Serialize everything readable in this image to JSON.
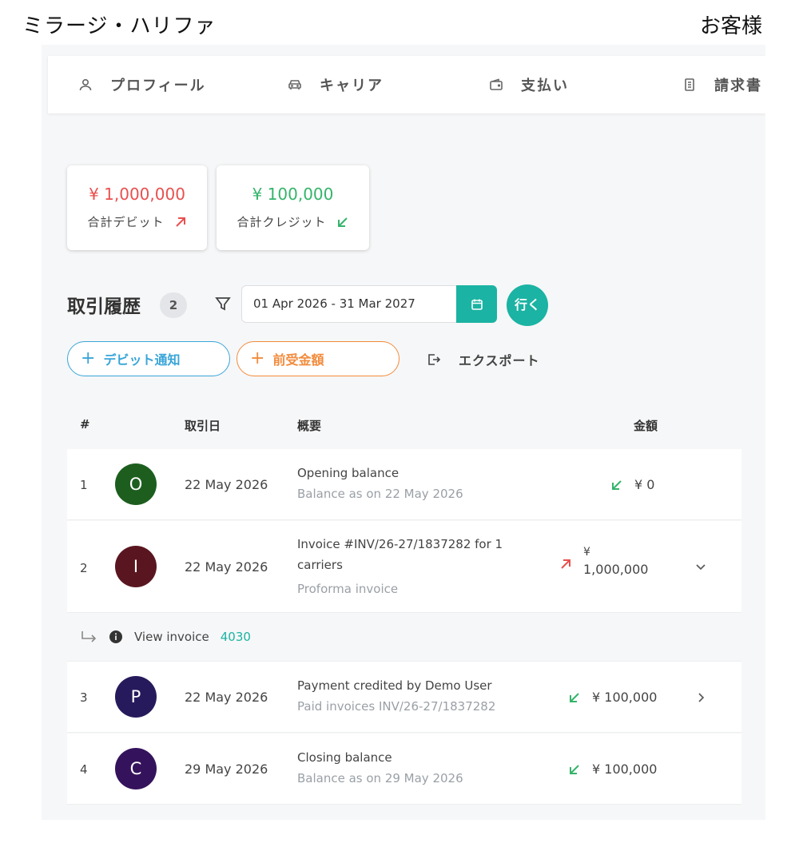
{
  "header": {
    "customer_name": "ミラージ・ハリファ",
    "customer_role": "お客様"
  },
  "tabs": [
    {
      "label": "プロフィール",
      "icon": "user-icon"
    },
    {
      "label": "キャリア",
      "icon": "car-icon"
    },
    {
      "label": "支払い",
      "icon": "wallet-icon"
    },
    {
      "label": "請求書",
      "icon": "document-icon"
    }
  ],
  "summary": {
    "debit": {
      "amount": "¥ 1,000,000",
      "label": "合計デビット",
      "color": "#e8504f"
    },
    "credit": {
      "amount": "¥ 100,000",
      "label": "合計クレジット",
      "color": "#35b46b"
    }
  },
  "history": {
    "title": "取引履歴",
    "count": "2",
    "date_range": "01 Apr 2026 - 31 Mar 2027",
    "go_label": "行く",
    "debit_note_label": "デビット通知",
    "advance_label": "前受金額",
    "export_label": "エクスポート"
  },
  "table": {
    "headers": {
      "num": "#",
      "date": "取引日",
      "desc": "概要",
      "amount": "金額"
    },
    "rows": [
      {
        "num": "1",
        "avatar": "O",
        "avatar_color": "#1d5e1f",
        "date": "22 May 2026",
        "title": "Opening balance",
        "subtitle": "Balance as on 22 May 2026",
        "amount": "¥ 0",
        "direction": "credit"
      },
      {
        "num": "2",
        "avatar": "I",
        "avatar_color": "#5a1620",
        "date": "22 May 2026",
        "title": "Invoice #INV/26-27/1837282 for 1 carriers",
        "subtitle": "Proforma invoice",
        "amount_symbol": "¥",
        "amount": "1,000,000",
        "direction": "debit"
      },
      {
        "num": "3",
        "avatar": "P",
        "avatar_color": "#271a5c",
        "date": "22 May 2026",
        "title": "Payment credited by Demo User",
        "subtitle": "Paid invoices INV/26-27/1837282",
        "amount": "¥ 100,000",
        "direction": "credit"
      },
      {
        "num": "4",
        "avatar": "C",
        "avatar_color": "#35135c",
        "date": "29 May 2026",
        "title": "Closing balance",
        "subtitle": "Balance as on 29 May 2026",
        "amount": "¥ 100,000",
        "direction": "credit"
      }
    ],
    "subrow": {
      "label": "View invoice",
      "link": "4030"
    }
  }
}
